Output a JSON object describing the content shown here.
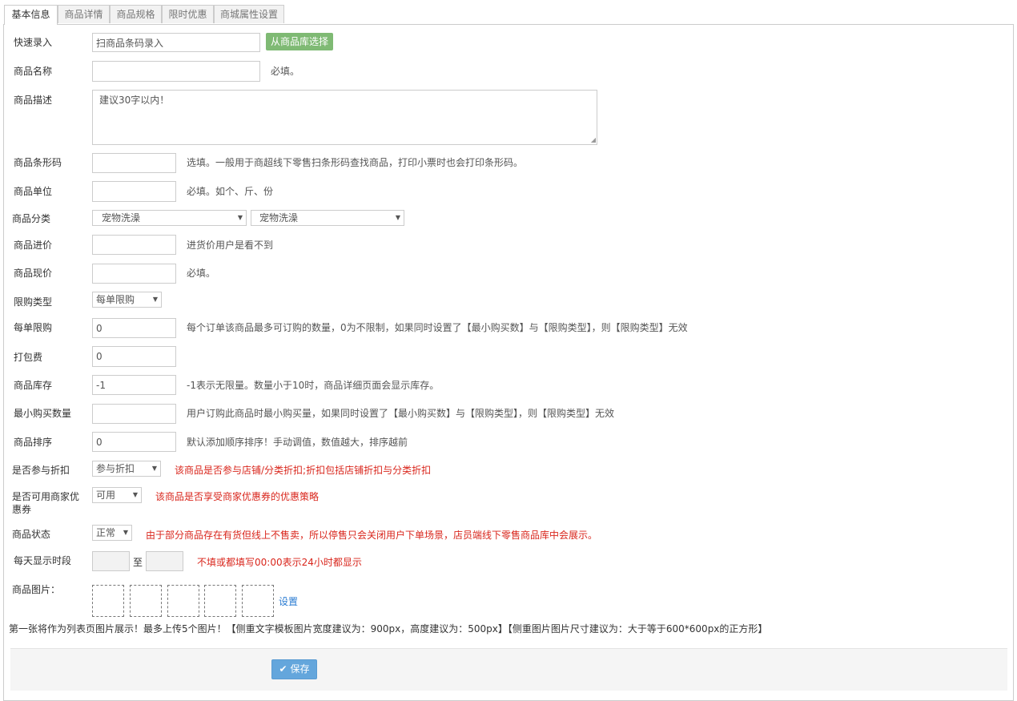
{
  "tabs": [
    "基本信息",
    "商品详情",
    "商品规格",
    "限时优惠",
    "商城属性设置"
  ],
  "quick_entry": {
    "label": "快速录入",
    "placeholder": "扫商品条码录入",
    "button": "从商品库选择"
  },
  "name": {
    "label": "商品名称",
    "value": "",
    "hint": "必填。"
  },
  "description": {
    "label": "商品描述",
    "placeholder": "建议30字以内！"
  },
  "barcode": {
    "label": "商品条形码",
    "value": "",
    "hint": "选填。一般用于商超线下零售扫条形码查找商品，打印小票时也会打印条形码。"
  },
  "unit": {
    "label": "商品单位",
    "value": "",
    "hint": "必填。如个、斤、份"
  },
  "category": {
    "label": "商品分类",
    "primary": "宠物洗澡",
    "secondary": "宠物洗澡"
  },
  "purchase_price": {
    "label": "商品进价",
    "value": "",
    "hint": "进货价用户是看不到"
  },
  "current_price": {
    "label": "商品现价",
    "value": "",
    "hint": "必填。"
  },
  "limit_type": {
    "label": "限购类型",
    "value": "每单限购"
  },
  "per_order_limit": {
    "label": "每单限购",
    "value": "0",
    "hint": "每个订单该商品最多可订购的数量，0为不限制，如果同时设置了【最小购买数】与【限购类型】，则【限购类型】无效"
  },
  "packing_fee": {
    "label": "打包费",
    "value": "0"
  },
  "stock": {
    "label": "商品库存",
    "value": "-1",
    "hint": "-1表示无限量。数量小于10时，商品详细页面会显示库存。"
  },
  "min_purchase": {
    "label": "最小购买数量",
    "value": "",
    "hint": "用户订购此商品时最小购买量，如果同时设置了【最小购买数】与【限购类型】，则【限购类型】无效"
  },
  "sort": {
    "label": "商品排序",
    "value": "0",
    "hint": "默认添加顺序排序！手动调值，数值越大，排序越前"
  },
  "discount": {
    "label": "是否参与折扣",
    "value": "参与折扣",
    "hint": "该商品是否参与店铺/分类折扣;折扣包括店铺折扣与分类折扣"
  },
  "coupon": {
    "label_line1": "是否可用商家优",
    "label_line2": "惠券",
    "value": "可用",
    "hint": "该商品是否享受商家优惠券的优惠策略"
  },
  "status": {
    "label": "商品状态",
    "value": "正常",
    "hint": "由于部分商品存在有货但线上不售卖，所以停售只会关闭用户下单场景，店员端线下零售商品库中会展示。"
  },
  "display_time": {
    "label": "每天显示时段",
    "separator": "至",
    "hint": "不填或都填写00:00表示24小时都显示"
  },
  "images": {
    "label": "商品图片：",
    "link": "设置",
    "note": "第一张将作为列表页图片展示！最多上传5个图片！【侧重文字模板图片宽度建议为：900px，高度建议为：500px】【侧重图片图片尺寸建议为：大于等于600*600px的正方形】"
  },
  "save_label": "保存",
  "colors": {
    "green_button": "#7fba74",
    "save_button": "#64a6dc",
    "hint_red": "#d9261c",
    "link_blue": "#2a7bd2"
  }
}
